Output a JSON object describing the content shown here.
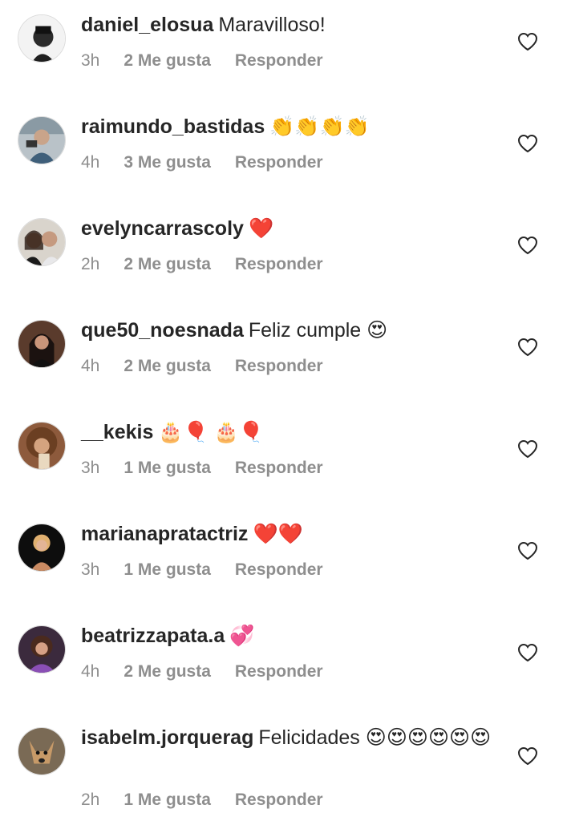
{
  "colors": {
    "text": "#262626",
    "meta": "#8e8e8e",
    "heart_outline": "#262626"
  },
  "comments": [
    {
      "username": "daniel_elosua",
      "text": "Maravilloso!",
      "time": "3h",
      "likes": "2 Me gusta",
      "reply": "Responder",
      "avatar": "avatar-man-dark"
    },
    {
      "username": "raimundo_bastidas",
      "text": "👏👏👏👏",
      "time": "4h",
      "likes": "3 Me gusta",
      "reply": "Responder",
      "avatar": "avatar-man-camera"
    },
    {
      "username": "evelyncarrascoly",
      "text": "❤️",
      "time": "2h",
      "likes": "2 Me gusta",
      "reply": "Responder",
      "avatar": "avatar-couple"
    },
    {
      "username": "que50_noesnada",
      "text": "Feliz cumple 😍",
      "time": "4h",
      "likes": "2 Me gusta",
      "reply": "Responder",
      "avatar": "avatar-woman-dark-hair"
    },
    {
      "username": "__kekis",
      "text": "🎂🎈 🎂🎈",
      "time": "3h",
      "likes": "1 Me gusta",
      "reply": "Responder",
      "avatar": "avatar-woman-curly-hair"
    },
    {
      "username": "marianapratactriz",
      "text": "❤️❤️",
      "time": "3h",
      "likes": "1 Me gusta",
      "reply": "Responder",
      "avatar": "avatar-woman-black-background"
    },
    {
      "username": "beatrizzapata.a",
      "text": "💞",
      "time": "4h",
      "likes": "2 Me gusta",
      "reply": "Responder",
      "avatar": "avatar-woman-purple"
    },
    {
      "username": "isabelm.jorquerag",
      "text": "Felicidades 😍😍😍😍😍😍",
      "time": "2h",
      "likes": "1 Me gusta",
      "reply": "Responder",
      "avatar": "avatar-dog"
    }
  ],
  "icons": {
    "like": "heart-outline-icon"
  }
}
